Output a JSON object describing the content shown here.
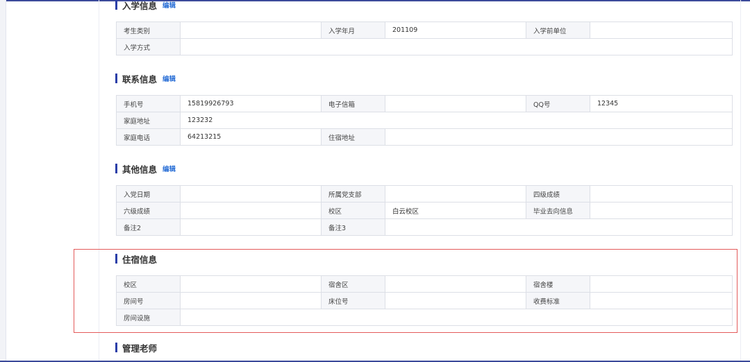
{
  "sections": {
    "enrollment": {
      "title": "入学信息",
      "edit_label": "编辑",
      "rows": [
        [
          {
            "label": "考生类别",
            "value": ""
          },
          {
            "label": "入学年月",
            "value": "201109"
          },
          {
            "label": "入学前单位",
            "value": ""
          }
        ],
        [
          {
            "label": "入学方式",
            "value": ""
          }
        ]
      ]
    },
    "contact": {
      "title": "联系信息",
      "edit_label": "编辑",
      "rows": [
        [
          {
            "label": "手机号",
            "value": "15819926793"
          },
          {
            "label": "电子信箱",
            "value": ""
          },
          {
            "label": "QQ号",
            "value": "12345"
          }
        ],
        [
          {
            "label": "家庭地址",
            "value": "123232"
          }
        ],
        [
          {
            "label": "家庭电话",
            "value": "64213215"
          },
          {
            "label": "住宿地址",
            "value": ""
          }
        ]
      ]
    },
    "other": {
      "title": "其他信息",
      "edit_label": "编辑",
      "rows": [
        [
          {
            "label": "入党日期",
            "value": ""
          },
          {
            "label": "所属党支部",
            "value": ""
          },
          {
            "label": "四级成绩",
            "value": ""
          }
        ],
        [
          {
            "label": "六级成绩",
            "value": ""
          },
          {
            "label": "校区",
            "value": "白云校区"
          },
          {
            "label": "毕业去向信息",
            "value": ""
          }
        ],
        [
          {
            "label": "备注2",
            "value": ""
          },
          {
            "label": "备注3",
            "value": ""
          }
        ]
      ]
    },
    "dorm": {
      "title": "住宿信息",
      "rows": [
        [
          {
            "label": "校区",
            "value": ""
          },
          {
            "label": "宿舍区",
            "value": ""
          },
          {
            "label": "宿舍楼",
            "value": ""
          }
        ],
        [
          {
            "label": "房间号",
            "value": ""
          },
          {
            "label": "床位号",
            "value": ""
          },
          {
            "label": "收费标准",
            "value": ""
          }
        ],
        [
          {
            "label": "房间设施",
            "value": ""
          }
        ]
      ]
    },
    "teacher": {
      "title": "管理老师"
    }
  },
  "colors": {
    "accent": "#2b3fa8",
    "edit_link": "#2a6fd6",
    "highlight_border": "#e35a5a",
    "label_bg": "#f5f6f9"
  }
}
